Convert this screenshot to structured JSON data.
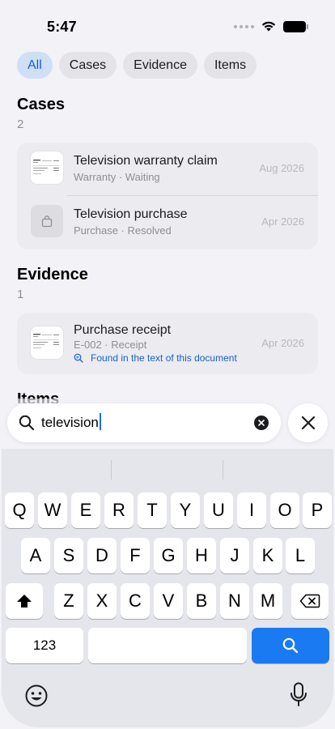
{
  "status": {
    "time": "5:47"
  },
  "filters": [
    {
      "label": "All",
      "selected": true
    },
    {
      "label": "Cases",
      "selected": false
    },
    {
      "label": "Evidence",
      "selected": false
    },
    {
      "label": "Items",
      "selected": false
    }
  ],
  "sections": {
    "cases": {
      "title": "Cases",
      "count": "2",
      "rows": [
        {
          "title": "Television warranty claim",
          "subtitle": "Warranty · Waiting",
          "date": "Aug 2026",
          "icon": "document-thumbnail"
        },
        {
          "title": "Television purchase",
          "subtitle": "Purchase · Resolved",
          "date": "Apr 2026",
          "icon": "shopping-bag-icon"
        }
      ]
    },
    "evidence": {
      "title": "Evidence",
      "count": "1",
      "rows": [
        {
          "title": "Purchase receipt",
          "subtitle": "E-002 · Receipt",
          "date": "Apr 2026",
          "found_note": "Found in the text of this document",
          "icon": "document-thumbnail"
        }
      ]
    },
    "items": {
      "title": "Items"
    }
  },
  "search": {
    "value": "television"
  },
  "keyboard": {
    "row1": [
      "Q",
      "W",
      "E",
      "R",
      "T",
      "Y",
      "U",
      "I",
      "O",
      "P"
    ],
    "row2": [
      "A",
      "S",
      "D",
      "F",
      "G",
      "H",
      "J",
      "K",
      "L"
    ],
    "row3": [
      "Z",
      "X",
      "C",
      "V",
      "B",
      "N",
      "M"
    ],
    "numbers_label": "123"
  },
  "colors": {
    "accent": "#1a7af2",
    "chip_selected_bg": "#cfdff5",
    "chip_selected_text": "#1a5fc9"
  }
}
